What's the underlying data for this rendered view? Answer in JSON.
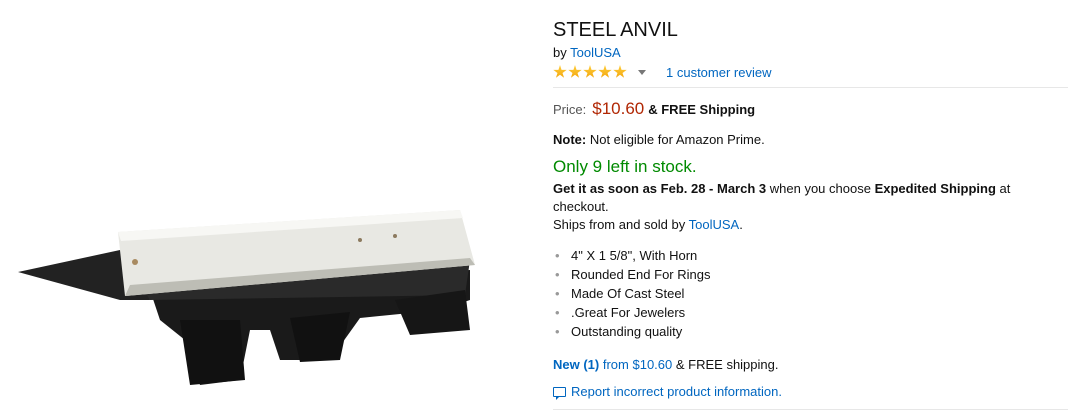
{
  "product": {
    "title": "STEEL ANVIL",
    "by_prefix": "by",
    "brand": "ToolUSA",
    "rating": {
      "stars": 5,
      "max_stars": 5,
      "review_link": "1 customer review"
    }
  },
  "price": {
    "label": "Price:",
    "amount": "$10.60",
    "shipping": "& FREE Shipping"
  },
  "note": {
    "label": "Note:",
    "text": "Not eligible for Amazon Prime."
  },
  "availability": {
    "stock": "Only 9 left in stock.",
    "delivery_prefix": "Get it as soon as Feb. 28 - March 3",
    "delivery_mid": "when you choose",
    "delivery_method": "Expedited Shipping",
    "delivery_suffix": "at checkout.",
    "ships_prefix": "Ships from and sold by",
    "seller": "ToolUSA",
    "ships_suffix": "."
  },
  "features": [
    "4\" X 1 5/8\", With Horn",
    "Rounded End For Rings",
    "Made Of Cast Steel",
    ".Great For Jewelers",
    "Outstanding quality"
  ],
  "offers": {
    "new_label": "New (1)",
    "from_text": "from",
    "from_price": "$10.60",
    "shipping_text": "& FREE shipping."
  },
  "report": {
    "label": "Report incorrect product information."
  },
  "colors": {
    "link": "#0066c0",
    "price": "#b12704",
    "in_stock": "#008a00",
    "star": "#f2a40a"
  },
  "icons": [
    "chevron-down-icon",
    "report-feedback-icon",
    "star-icon"
  ]
}
